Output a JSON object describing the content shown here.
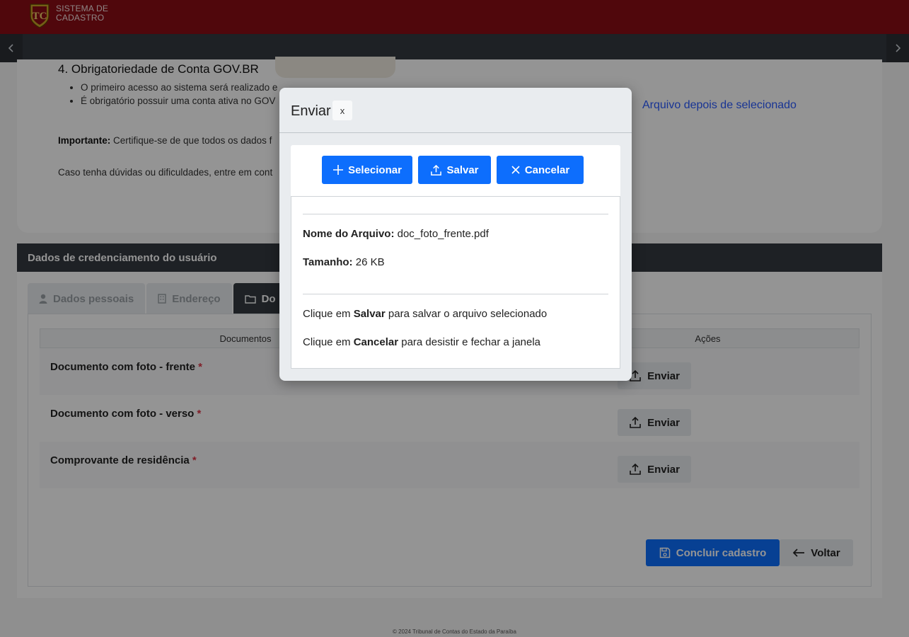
{
  "header": {
    "brand_line1": "SISTEMA DE",
    "brand_line2": "CADASTRO",
    "logo_icon": "tce-crest-icon",
    "bg_color": "#8b0d15"
  },
  "navbar": {
    "prev_icon": "chevron-left-icon",
    "next_icon": "chevron-right-icon"
  },
  "info_card": {
    "title": "4. Obrigatoriedade de Conta GOV.BR",
    "bullet1": "O primeiro acesso ao sistema será realizado e",
    "bullet2": "É obrigatório possuir uma conta ativa no GOV",
    "important_label": "Importante:",
    "important_text": " Certifique-se de que todos os dados f",
    "doubts_text": "Caso tenha dúvidas ou dificuldades, entre em cont",
    "side_link": "Arquivo depois de selecionado"
  },
  "credentials": {
    "title": "Dados de credenciamento do usuário",
    "tabs": [
      {
        "label": "Dados pessoais",
        "icon": "user-icon"
      },
      {
        "label": "Endereço",
        "icon": "building-icon"
      },
      {
        "label": "Do",
        "icon": "folder-icon"
      }
    ],
    "table": {
      "col_documents": "Documentos",
      "col_actions": "Ações",
      "rows": [
        {
          "label": "Documento com foto - frente",
          "required": "*",
          "action": "Enviar"
        },
        {
          "label": "Documento com foto - verso",
          "required": "*",
          "action": "Enviar"
        },
        {
          "label": "Comprovante de residência",
          "required": "*",
          "action": "Enviar"
        }
      ]
    },
    "finish_label": "Concluir cadastro",
    "back_label": "Voltar"
  },
  "footer": {
    "text": "© 2024 Tribunal de Contas do Estado da Paraíba"
  },
  "modal": {
    "title": "Enviar",
    "close_label": "x",
    "select_label": "Selecionar",
    "save_label": "Salvar",
    "cancel_label": "Cancelar",
    "file_name_label": "Nome do Arquivo:",
    "file_name": "doc_foto_frente.pdf",
    "size_label": "Tamanho:",
    "size": "26 KB",
    "hint1_pre": "Clique em ",
    "hint1_bold": "Salvar",
    "hint1_post": " para salvar o arquivo selecionado",
    "hint2_pre": "Clique em ",
    "hint2_bold": "Cancelar",
    "hint2_post": " para desistir e fechar a janela",
    "accent": "#0d6efd"
  }
}
